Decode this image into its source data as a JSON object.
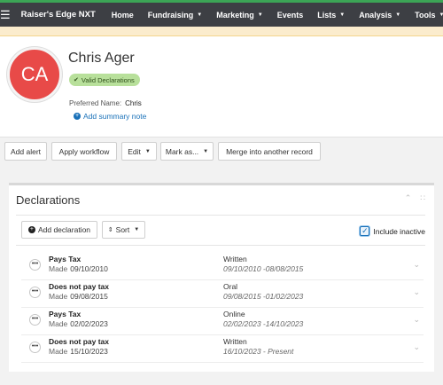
{
  "app": {
    "brand": "Raiser's Edge NXT",
    "nav": [
      {
        "label": "Home",
        "dropdown": false
      },
      {
        "label": "Fundraising",
        "dropdown": true
      },
      {
        "label": "Marketing",
        "dropdown": true
      },
      {
        "label": "Events",
        "dropdown": false
      },
      {
        "label": "Lists",
        "dropdown": true
      },
      {
        "label": "Analysis",
        "dropdown": true
      },
      {
        "label": "Tools",
        "dropdown": true
      }
    ]
  },
  "record": {
    "initials": "CA",
    "name": "Chris Ager",
    "badge": "Valid Declarations",
    "preferred_label": "Preferred Name:",
    "preferred_value": "Chris",
    "add_summary": "Add summary note",
    "avatar_color": "#e84a48",
    "badge_color": "#b8e09b"
  },
  "actions": {
    "add_alert": "Add alert",
    "apply_workflow": "Apply workflow",
    "edit": "Edit",
    "mark_as": "Mark as...",
    "merge": "Merge into another record"
  },
  "declarations": {
    "title": "Declarations",
    "add_label": "Add declaration",
    "sort_label": "Sort",
    "include_inactive_label": "Include inactive",
    "include_inactive_checked": true,
    "made_label": "Made",
    "rows": [
      {
        "status": "Pays Tax",
        "made": "09/10/2010",
        "type": "Written",
        "dates": "09/10/2010 -08/08/2015"
      },
      {
        "status": "Does not pay tax",
        "made": "09/08/2015",
        "type": "Oral",
        "dates": "09/08/2015 -01/02/2023"
      },
      {
        "status": "Pays Tax",
        "made": "02/02/2023",
        "type": "Online",
        "dates": "02/02/2023 -14/10/2023"
      },
      {
        "status": "Does not pay tax",
        "made": "15/10/2023",
        "type": "Written",
        "dates": "16/10/2023 - Present"
      }
    ]
  },
  "colors": {
    "topbar": "#3d3f44",
    "accent_green": "#3ca556",
    "link_blue": "#1870b8"
  }
}
